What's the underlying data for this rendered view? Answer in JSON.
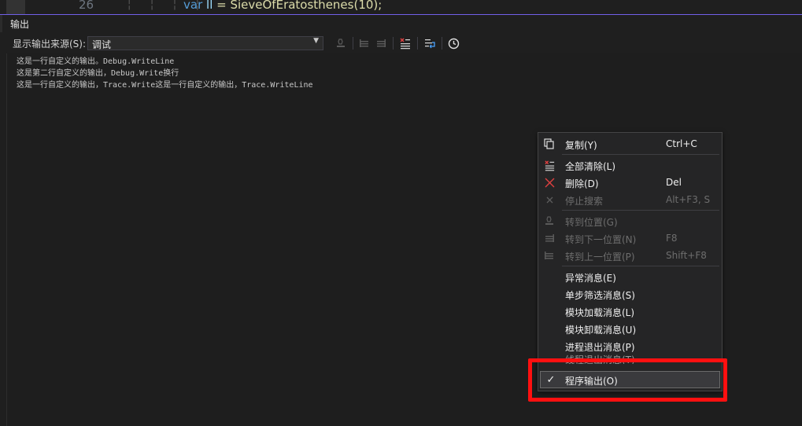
{
  "editor": {
    "line_number": "26",
    "indent_guides": "¦ ¦ ¦ ¦",
    "code_keyword": "var",
    "code_ident": "ll",
    "code_rest": " = SieveOfEratosthenes(10);"
  },
  "panel": {
    "title": "输出"
  },
  "toolbar": {
    "source_label": "显示输出来源(S):",
    "source_value": "调试",
    "icons": [
      "find-message-icon",
      "go-prev-icon",
      "go-next-icon",
      "clear-all-icon",
      "word-wrap-icon",
      "clock-icon"
    ]
  },
  "output": {
    "lines": [
      "这是一行自定义的输出。Debug.WriteLine",
      "这是第二行自定义的输出，Debug.Write换行",
      "这是一行自定义的输出，Trace.Write这是一行自定义的输出，Trace.WriteLine"
    ]
  },
  "context_menu": {
    "items": [
      {
        "label": "复制(Y)",
        "shortcut": "Ctrl+C",
        "icon": "copy-icon",
        "enabled": true
      },
      {
        "label": "全部清除(L)",
        "shortcut": "",
        "icon": "clear-all-icon",
        "enabled": true
      },
      {
        "label": "删除(D)",
        "shortcut": "Del",
        "icon": "delete-x-icon",
        "enabled": true
      },
      {
        "label": "停止搜索",
        "shortcut": "Alt+F3, S",
        "icon": "stop-search-icon",
        "enabled": false
      },
      {
        "label": "转到位置(G)",
        "shortcut": "",
        "icon": "goto-location-icon",
        "enabled": false
      },
      {
        "label": "转到下一位置(N)",
        "shortcut": "F8",
        "icon": "next-location-icon",
        "enabled": false
      },
      {
        "label": "转到上一位置(P)",
        "shortcut": "Shift+F8",
        "icon": "prev-location-icon",
        "enabled": false
      },
      {
        "label": "异常消息(E)",
        "shortcut": "",
        "enabled": true
      },
      {
        "label": "单步筛选消息(S)",
        "shortcut": "",
        "enabled": true
      },
      {
        "label": "模块加载消息(L)",
        "shortcut": "",
        "enabled": true
      },
      {
        "label": "模块卸载消息(U)",
        "shortcut": "",
        "enabled": true
      },
      {
        "label": "进程退出消息(P)",
        "shortcut": "",
        "enabled": true
      },
      {
        "label": "线程退出消息(T)",
        "shortcut": "",
        "enabled": true
      },
      {
        "label": "程序输出(O)",
        "shortcut": "",
        "enabled": true,
        "checked": true,
        "check_mark": "✓"
      }
    ]
  },
  "colors": {
    "highlight_box": "#ff1010",
    "accent": "#7160e8"
  }
}
